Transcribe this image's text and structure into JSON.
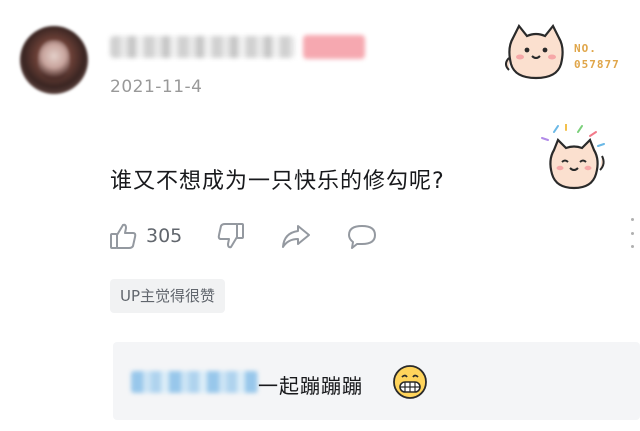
{
  "comment": {
    "date": "2021-11-4",
    "text": "谁又不想成为一只快乐的修勾呢?",
    "likes": "305",
    "up_tag": "UP主觉得很赞"
  },
  "badge": {
    "line1": "NO.",
    "line2": "057877"
  },
  "reply": {
    "text": "一起蹦蹦蹦"
  },
  "icons": {
    "like": "thumbs-up-icon",
    "dislike": "thumbs-down-icon",
    "share": "share-icon",
    "reply": "reply-bubble-icon",
    "more": "more-icon"
  },
  "colors": {
    "text": "#18191c",
    "muted": "#999999",
    "icon": "#9499a0",
    "badge": "#e0a64a"
  }
}
